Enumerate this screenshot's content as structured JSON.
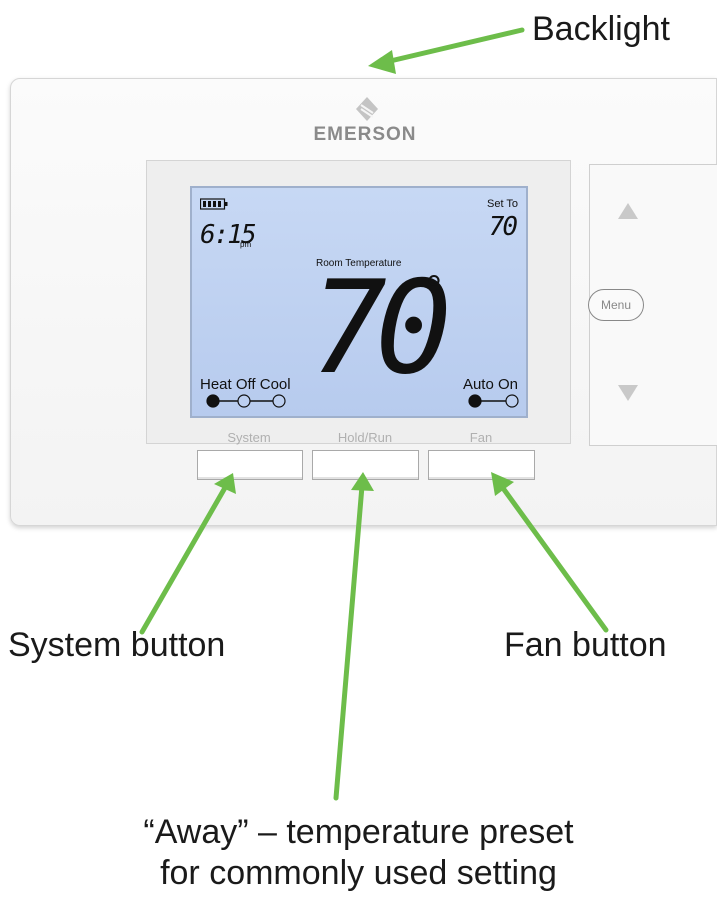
{
  "callouts": {
    "backlight": "Backlight",
    "system_button": "System button",
    "fan_button": "Fan button",
    "away_line1": "“Away” – temperature preset",
    "away_line2": "for commonly used setting"
  },
  "device": {
    "brand": "EMERSON",
    "display": {
      "time": "6:15",
      "time_suffix": "pm",
      "set_to_label": "Set To",
      "setpoint": "70",
      "room_temperature_label": "Room Temperature",
      "room_temperature": "70",
      "degree_symbol": "°",
      "mode_labels": "Heat Off Cool",
      "fan_labels": "Auto On"
    },
    "buttons": {
      "system": "System",
      "hold_run": "Hold/Run",
      "fan": "Fan",
      "menu": "Menu"
    }
  },
  "colors": {
    "arrow": "#6dbd4a",
    "lcd_backlight": "#bccff0"
  },
  "icons": [
    "battery-icon",
    "up-arrow-icon",
    "down-arrow-icon",
    "emerson-logo-icon",
    "slider-knob-icon"
  ]
}
